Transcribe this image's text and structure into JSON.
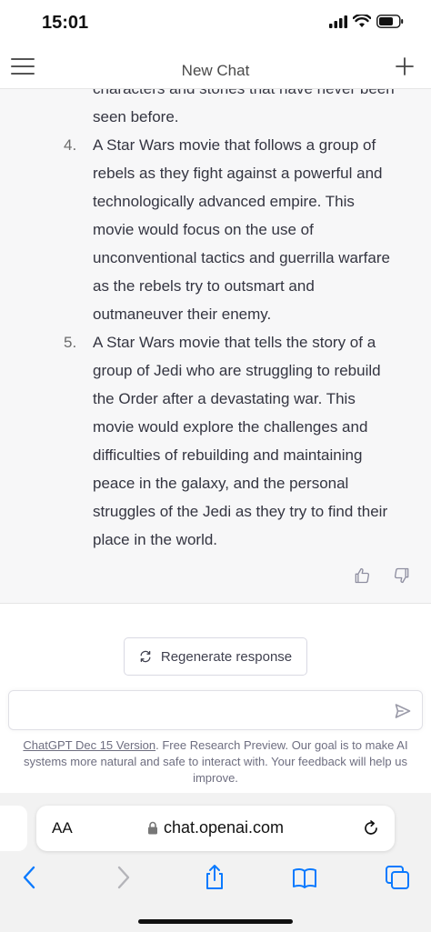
{
  "status_bar": {
    "time": "15:01"
  },
  "header": {
    "title": "New Chat"
  },
  "response": {
    "intro_lines": [
      "characters and stories that have never been",
      "seen before."
    ],
    "items": [
      {
        "number": "4.",
        "lines": [
          "A Star Wars movie that follows a group of",
          "rebels as they fight against a powerful and",
          "technologically advanced empire. This",
          "movie would focus on the use of",
          "unconventional tactics and guerrilla warfare",
          "as the rebels try to outsmart and",
          "outmaneuver their enemy."
        ]
      },
      {
        "number": "5.",
        "lines": [
          "A Star Wars movie that tells the story of a",
          "group of Jedi who are struggling to rebuild",
          "the Order after a devastating war. This",
          "movie would explore the challenges and",
          "difficulties of rebuilding and maintaining",
          "peace in the galaxy, and the personal",
          "struggles of the Jedi as they try to find their",
          "place in the world."
        ]
      }
    ]
  },
  "regenerate": {
    "label": "Regenerate response"
  },
  "composer": {
    "placeholder": ""
  },
  "disclaimer": {
    "link": "ChatGPT Dec 15 Version",
    "text": ". Free Research Preview. Our goal is to make AI systems more natural and safe to interact with. Your feedback will help us improve."
  },
  "browser": {
    "text_size_label": "AA",
    "url": "chat.openai.com"
  },
  "icons": {
    "menu": "hamburger-icon",
    "new_chat": "plus-icon",
    "thumbs_up": "thumbs-up-icon",
    "thumbs_down": "thumbs-down-icon",
    "regenerate": "refresh-icon",
    "send": "send-icon",
    "lock": "lock-icon",
    "reload": "reload-icon",
    "back": "chevron-left-icon",
    "forward": "chevron-right-icon",
    "share": "share-icon",
    "bookmarks": "book-icon",
    "tabs": "tabs-icon"
  },
  "colors": {
    "response_bg": "#f7f7f8",
    "text": "#343541",
    "ios_blue": "#0a7aff"
  }
}
